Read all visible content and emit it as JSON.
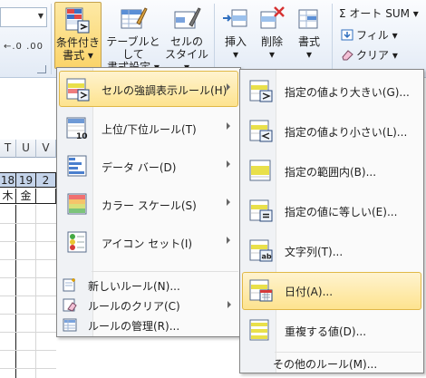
{
  "ribbon": {
    "conditional_formatting": {
      "line1": "条件付き",
      "line2": "書式 ▾"
    },
    "table_format": {
      "line1": "テーブルとして",
      "line2": "書式設定 ▾"
    },
    "cell_styles": {
      "line1": "セルの",
      "line2": "スタイル ▾"
    },
    "insert": {
      "line1": "挿入",
      "line2": "▾"
    },
    "delete": {
      "line1": "削除",
      "line2": "▾"
    },
    "format": {
      "line1": "書式",
      "line2": "▾"
    },
    "autosum": "Σ オート SUM ▾",
    "fill": "フィル ▾",
    "clear": "クリア ▾",
    "num_decimal": "←.0 .00"
  },
  "sheet": {
    "column_headers": [
      "T",
      "U",
      "V"
    ],
    "row_numbers": [
      "18",
      "19",
      "2"
    ],
    "row_days": [
      "木",
      "金",
      ""
    ]
  },
  "menu": {
    "items": [
      {
        "label": "セルの強調表示ルール(H)",
        "icon": "highlight-rules-icon",
        "submenu": true,
        "active": true
      },
      {
        "label": "上位/下位ルール(T)",
        "icon": "top-bottom-icon",
        "submenu": true
      },
      {
        "label": "データ バー(D)",
        "icon": "data-bars-icon",
        "submenu": true
      },
      {
        "label": "カラー スケール(S)",
        "icon": "color-scale-icon",
        "submenu": true
      },
      {
        "label": "アイコン セット(I)",
        "icon": "icon-sets-icon",
        "submenu": true
      }
    ],
    "commands": [
      {
        "label": "新しいルール(N)...",
        "icon": "new-rule-icon"
      },
      {
        "label": "ルールのクリア(C)",
        "icon": "clear-rules-icon",
        "submenu": true
      },
      {
        "label": "ルールの管理(R)...",
        "icon": "manage-rules-icon"
      }
    ]
  },
  "submenu": {
    "items": [
      {
        "label": "指定の値より大きい(G)...",
        "icon": "greater-than-icon"
      },
      {
        "label": "指定の値より小さい(L)...",
        "icon": "less-than-icon"
      },
      {
        "label": "指定の範囲内(B)...",
        "icon": "between-icon"
      },
      {
        "label": "指定の値に等しい(E)...",
        "icon": "equal-to-icon"
      },
      {
        "label": "文字列(T)...",
        "icon": "text-contains-icon"
      },
      {
        "label": "日付(A)...",
        "icon": "date-occurring-icon",
        "active": true
      },
      {
        "label": "重複する値(D)...",
        "icon": "duplicate-values-icon"
      }
    ],
    "more_rules": "その他のルール(M)..."
  },
  "colors": {
    "highlight": "#fde38f",
    "highlight_border": "#e0b848",
    "header_blue": "#c5d4ea"
  }
}
